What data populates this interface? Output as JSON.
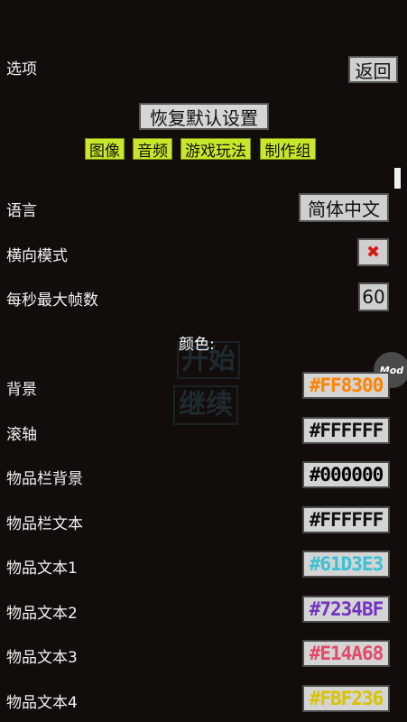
{
  "header": {
    "title": "选项",
    "back_label": "返回"
  },
  "reset_label": "恢复默认设置",
  "tabs": [
    "图像",
    "音频",
    "游戏玩法",
    "制作组"
  ],
  "settings": {
    "language": {
      "label": "语言",
      "value": "简体中文"
    },
    "landscape": {
      "label": "横向模式",
      "value": "✖"
    },
    "fps": {
      "label": "每秒最大帧数",
      "value": "60"
    }
  },
  "colors_heading": "颜色:",
  "colors": [
    {
      "label": "背景",
      "value": "#FF8300",
      "color": "#FF8300"
    },
    {
      "label": "滚轴",
      "value": "#FFFFFF",
      "color": "#111111"
    },
    {
      "label": "物品栏背景",
      "value": "#000000",
      "color": "#000000"
    },
    {
      "label": "物品栏文本",
      "value": "#FFFFFF",
      "color": "#111111"
    },
    {
      "label": "物品文本1",
      "value": "#61D3E3",
      "color": "#3cc0d4"
    },
    {
      "label": "物品文本2",
      "value": "#7234BF",
      "color": "#7234BF"
    },
    {
      "label": "物品文本3",
      "value": "#E14A68",
      "color": "#E14A68"
    },
    {
      "label": "物品文本4",
      "value": "#FBF236",
      "color": "#d9c400"
    }
  ],
  "background_ghost": {
    "start": "开始",
    "continue": "继续"
  },
  "mod_badge": "Mod"
}
